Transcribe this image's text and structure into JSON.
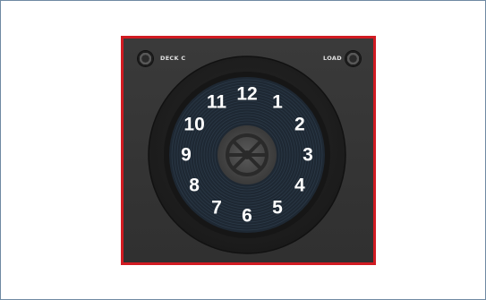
{
  "deck": {
    "left_label": "DECK C",
    "right_label": "LOAD",
    "border_color": "#d11b22",
    "center_logo_icon": "native-instruments-logo-icon",
    "jog_numbers": [
      "12",
      "1",
      "2",
      "3",
      "4",
      "5",
      "6",
      "7",
      "8",
      "9",
      "10",
      "11"
    ]
  }
}
